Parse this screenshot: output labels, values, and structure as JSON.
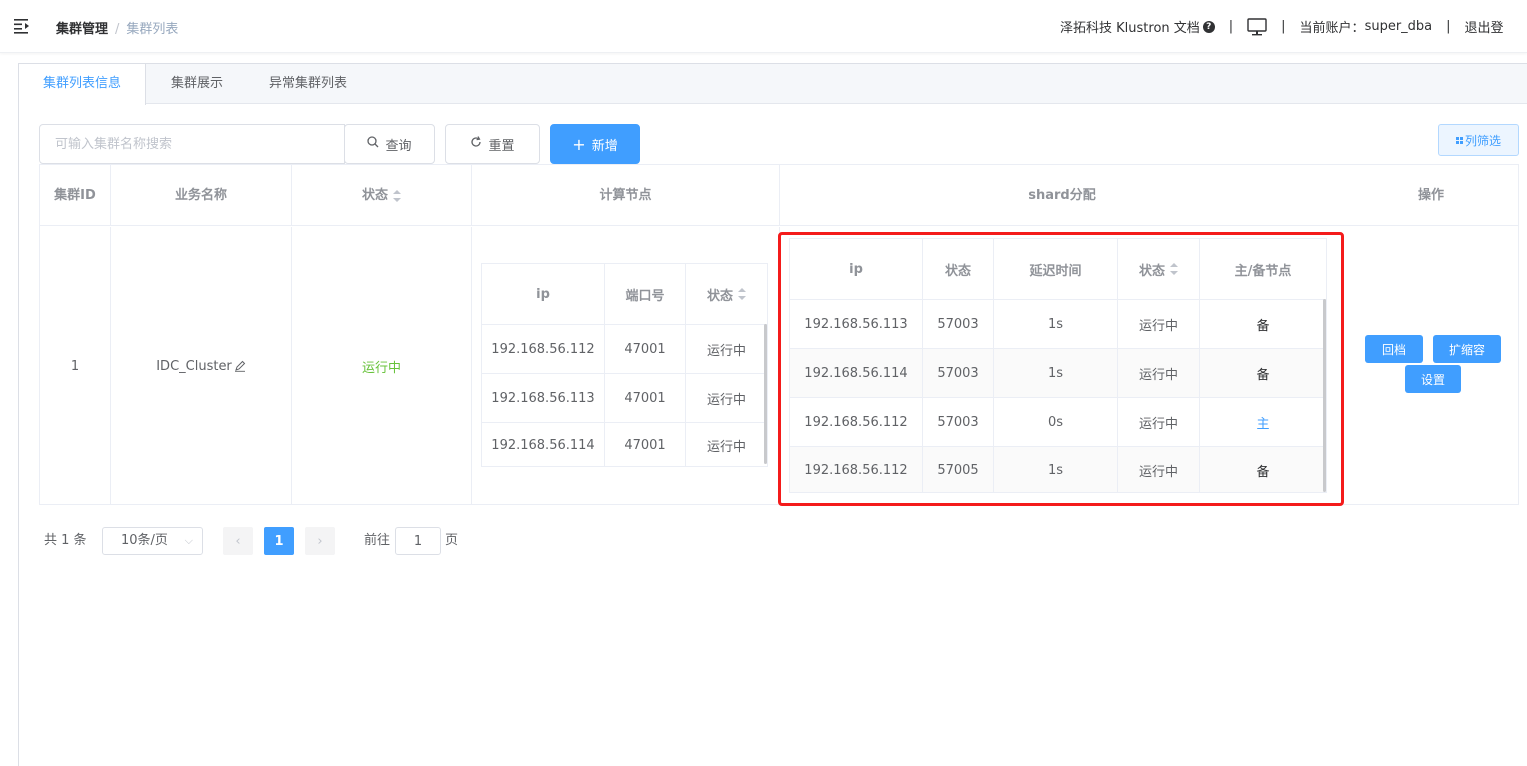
{
  "header": {
    "breadcrumb": [
      "集群管理",
      "集群列表"
    ],
    "company_docs": "泽拓科技 Klustron 文档",
    "current_account_label": "当前账户：",
    "current_account": "super_dba",
    "logout": "退出登"
  },
  "tabs": [
    "集群列表信息",
    "集群展示",
    "异常集群列表"
  ],
  "toolbar": {
    "search_placeholder": "可输入集群名称搜索",
    "query": "查询",
    "reset": "重置",
    "add": "新增",
    "column_filter": "列筛选"
  },
  "table": {
    "headers": {
      "cluster_id": "集群ID",
      "business_name": "业务名称",
      "status": "状态",
      "compute_nodes": "计算节点",
      "shard": "shard分配",
      "operation": "操作"
    },
    "row": {
      "cluster_id": "1",
      "business_name": "IDC_Cluster",
      "status": "运行中"
    },
    "compute": {
      "headers": [
        "ip",
        "端口号",
        "状态"
      ],
      "rows": [
        [
          "192.168.56.112",
          "47001",
          "运行中"
        ],
        [
          "192.168.56.113",
          "47001",
          "运行中"
        ],
        [
          "192.168.56.114",
          "47001",
          "运行中"
        ]
      ]
    },
    "shard_table": {
      "headers": [
        "ip",
        "状态",
        "延迟时间",
        "状态",
        "主/备节点"
      ],
      "rows": [
        [
          "192.168.56.113",
          "57003",
          "1s",
          "运行中",
          "备"
        ],
        [
          "192.168.56.114",
          "57003",
          "1s",
          "运行中",
          "备"
        ],
        [
          "192.168.56.112",
          "57003",
          "0s",
          "运行中",
          "主"
        ],
        [
          "192.168.56.112",
          "57005",
          "1s",
          "运行中",
          "备"
        ]
      ]
    },
    "ops": {
      "rollback": "回档",
      "scale": "扩缩容",
      "settings": "设置"
    }
  },
  "pagination": {
    "total": "共 1 条",
    "page_size": "10条/页",
    "current_page": "1",
    "goto_label": "前往",
    "goto_value": "1",
    "page_suffix": "页"
  },
  "colors": {
    "primary": "#409eff",
    "running": "#67c23a",
    "highlight": "#f41b1b"
  }
}
